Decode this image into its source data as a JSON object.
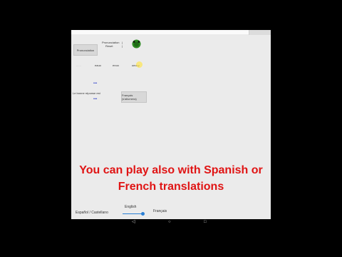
{
  "header": {
    "pronunciation_label": "Pronunciation",
    "reset_label": "Reset"
  },
  "buttons": {
    "pronunciation": "Pronunciation",
    "show_answer": "Français (s'allumera)"
  },
  "words": [
    "......",
    "eauo",
    "enoo",
    "oeouy"
  ],
  "dots": {
    "row1": "•••",
    "row2": "•••"
  },
  "sentence_label": "Le bonne réponse est",
  "overlay_line1": "You can play also with Spanish or",
  "overlay_line2": "French translations",
  "language": {
    "current": "English",
    "left": "Español / Castellano",
    "right": "Français",
    "slider_value": 1
  },
  "colors": {
    "overlay_text": "#e01414",
    "accent": "#2a7fd4",
    "turtle": "#2e8b22"
  },
  "icons": {
    "turtle": "turtle-icon",
    "nav_back": "back-icon",
    "nav_home": "home-icon",
    "nav_recent": "recents-icon"
  }
}
